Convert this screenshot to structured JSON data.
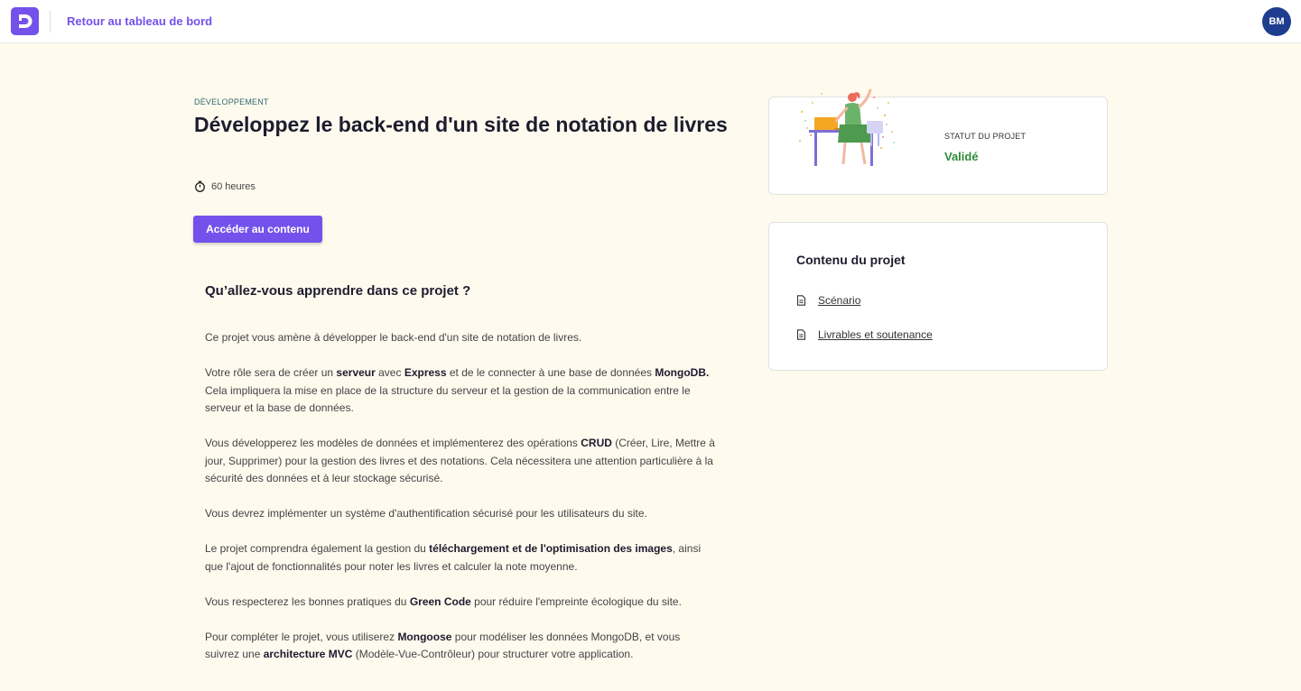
{
  "header": {
    "back_label": "Retour au tableau de bord",
    "avatar_initials": "BM",
    "brand_color": "#7451eb"
  },
  "project": {
    "category": "DÉVELOPPEMENT",
    "title": "Développez le back-end d'un site de notation de livres",
    "duration": "60 heures",
    "cta_label": "Accéder au contenu",
    "learn_heading": "Qu’allez-vous apprendre dans ce projet ?",
    "paragraphs": [
      [
        {
          "t": "Ce projet vous amène à développer le back-end d'un site de notation de livres."
        }
      ],
      [
        {
          "t": "Votre rôle sera de créer un "
        },
        {
          "t": "serveur",
          "b": true
        },
        {
          "t": " avec "
        },
        {
          "t": "Express",
          "b": true
        },
        {
          "t": " et de le connecter à une base de données "
        },
        {
          "t": "MongoDB.",
          "b": true
        },
        {
          "t": " Cela impliquera la mise en place de la structure du serveur et la gestion de la communication entre le serveur et la base de données."
        }
      ],
      [
        {
          "t": "Vous développerez les modèles de données et implémenterez des opérations "
        },
        {
          "t": "CRUD",
          "b": true
        },
        {
          "t": " (Créer, Lire, Mettre à jour, Supprimer) pour la gestion des livres et des notations. Cela nécessitera une attention particulière à la sécurité des données et à leur stockage sécurisé."
        }
      ],
      [
        {
          "t": "Vous devrez implémenter un système d'authentification sécurisé pour les utilisateurs du site."
        }
      ],
      [
        {
          "t": "Le projet comprendra également la gestion du "
        },
        {
          "t": "téléchargement et de l'optimisation des images",
          "b": true
        },
        {
          "t": ", ainsi que l'ajout de fonctionnalités pour noter les livres et calculer la note moyenne."
        }
      ],
      [
        {
          "t": "Vous respecterez les bonnes pratiques du "
        },
        {
          "t": "Green Code",
          "b": true
        },
        {
          "t": " pour réduire l'empreinte écologique du site."
        }
      ],
      [
        {
          "t": "Pour compléter le projet, vous utiliserez "
        },
        {
          "t": "Mongoose",
          "b": true
        },
        {
          "t": " pour modéliser les données MongoDB, et vous suivrez une "
        },
        {
          "t": "architecture MVC",
          "b": true
        },
        {
          "t": " (Modèle-Vue-Contrôleur) pour structurer votre application."
        }
      ]
    ]
  },
  "status": {
    "label": "STATUT DU PROJET",
    "value": "Validé",
    "value_color": "#2e8b3a"
  },
  "contents": {
    "title": "Contenu du projet",
    "items": [
      {
        "label": "Scénario",
        "icon": "document-icon"
      },
      {
        "label": "Livrables et soutenance",
        "icon": "document-icon"
      }
    ]
  }
}
